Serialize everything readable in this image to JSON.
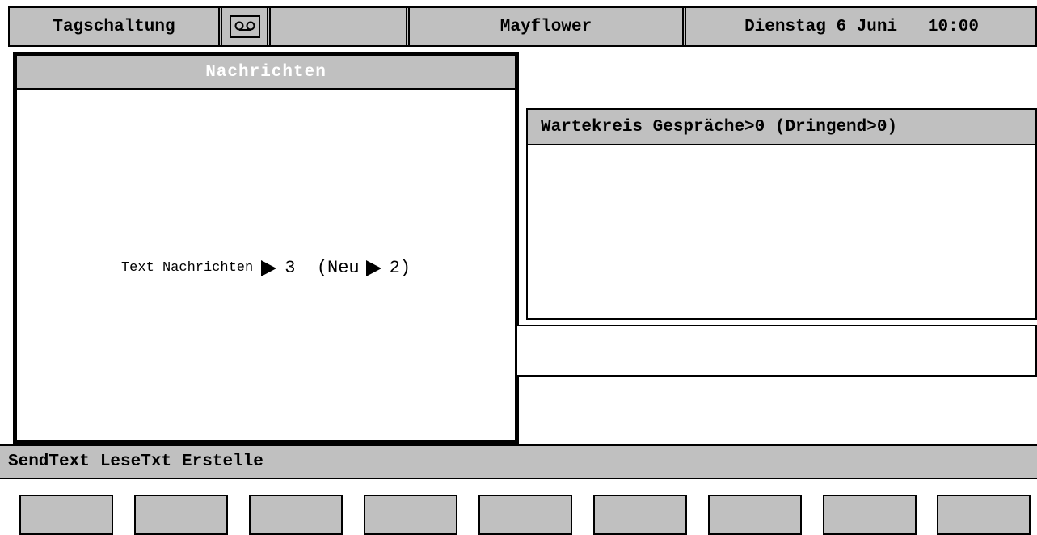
{
  "topbar": {
    "mode": "Tagschaltung",
    "tape_icon": "cassette-tape-icon",
    "name": "Mayflower",
    "date": "Dienstag 6 Juni",
    "time": "10:00"
  },
  "messages": {
    "title": "Nachrichten",
    "label": "Text Nachrichten",
    "count": "3",
    "new_label": "(Neu",
    "new_count": "2)"
  },
  "queue": {
    "title": "Wartekreis Gespräche>0 (Dringend>0)"
  },
  "softkeys": [
    "SendText",
    "LeseTxt",
    "Erstelle"
  ],
  "keys": [
    "",
    "",
    "",
    "",
    "",
    "",
    "",
    "",
    ""
  ],
  "colors": {
    "panel_gray": "#c0c0c0",
    "border": "#000000",
    "background": "#ffffff",
    "title_text_white": "#ffffff"
  }
}
